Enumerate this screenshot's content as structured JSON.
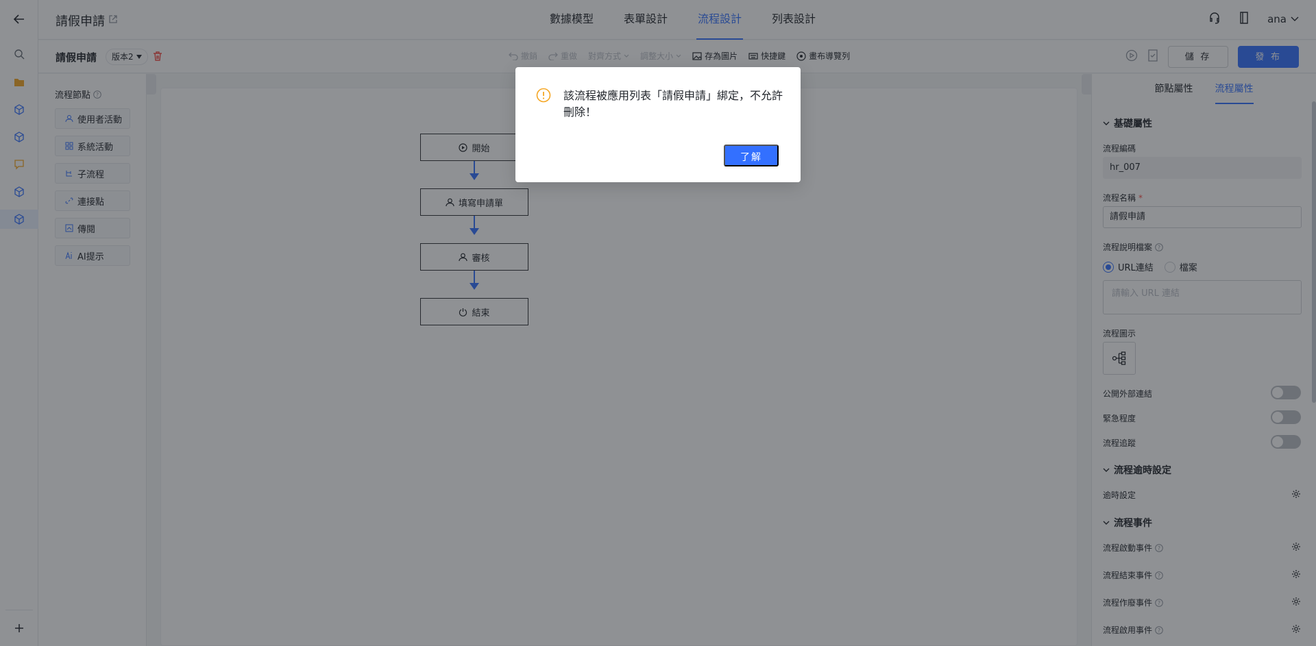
{
  "header": {
    "title": "請假申請",
    "tabs": [
      {
        "label": "數據模型"
      },
      {
        "label": "表單設計"
      },
      {
        "label": "流程設計"
      },
      {
        "label": "列表設計"
      }
    ],
    "user": "ana"
  },
  "toolbar": {
    "process_name": "請假申請",
    "version": "版本2",
    "tools": [
      {
        "label": "撤銷",
        "disabled": true
      },
      {
        "label": "重做",
        "disabled": true
      },
      {
        "label": "對齊方式",
        "disabled": true
      },
      {
        "label": "調整大小",
        "disabled": true
      },
      {
        "label": "存為圖片",
        "disabled": false
      },
      {
        "label": "快捷鍵",
        "disabled": false
      },
      {
        "label": "畫布導覽列",
        "disabled": false
      }
    ],
    "save_label": "儲 存",
    "publish_label": "發 布"
  },
  "palette": {
    "title": "流程節點",
    "items": [
      {
        "label": "使用者活動",
        "icon": "user-icon"
      },
      {
        "label": "系統活動",
        "icon": "grid-icon"
      },
      {
        "label": "子流程",
        "icon": "subflow-icon"
      },
      {
        "label": "連接點",
        "icon": "link-icon"
      },
      {
        "label": "傳閱",
        "icon": "circulate-icon"
      },
      {
        "label": "AI提示",
        "icon": "ai-icon"
      }
    ]
  },
  "canvas": {
    "nodes": [
      {
        "label": "開始",
        "icon": "play-icon"
      },
      {
        "label": "填寫申請單",
        "icon": "user-icon"
      },
      {
        "label": "審核",
        "icon": "user-icon"
      },
      {
        "label": "結束",
        "icon": "power-icon"
      }
    ]
  },
  "props": {
    "tabs": [
      {
        "label": "節點屬性"
      },
      {
        "label": "流程屬性"
      }
    ],
    "basic_section": "基礎屬性",
    "code_label": "流程編碼",
    "code_value": "hr_007",
    "name_label": "流程名稱",
    "name_value": "請假申請",
    "doc_label": "流程說明檔案",
    "doc_options": [
      "URL連結",
      "檔案"
    ],
    "url_placeholder": "請輸入 URL 連結",
    "icon_label": "流程圖示",
    "toggles": [
      {
        "label": "公開外部連結",
        "on": false
      },
      {
        "label": "緊急程度",
        "on": false
      },
      {
        "label": "流程追蹤",
        "on": false
      }
    ],
    "timeout_section": "流程逾時設定",
    "timeout_label": "逾時設定",
    "events_section": "流程事件",
    "events": [
      "流程啟動事件",
      "流程結束事件",
      "流程作廢事件",
      "流程啟用事件"
    ]
  },
  "modal": {
    "message": "該流程被應用列表「請假申請」綁定，不允許刪除！",
    "confirm_label": "了解"
  },
  "colors": {
    "accent": "#3370ff",
    "warning": "#f5a623",
    "danger": "#f54a45"
  }
}
